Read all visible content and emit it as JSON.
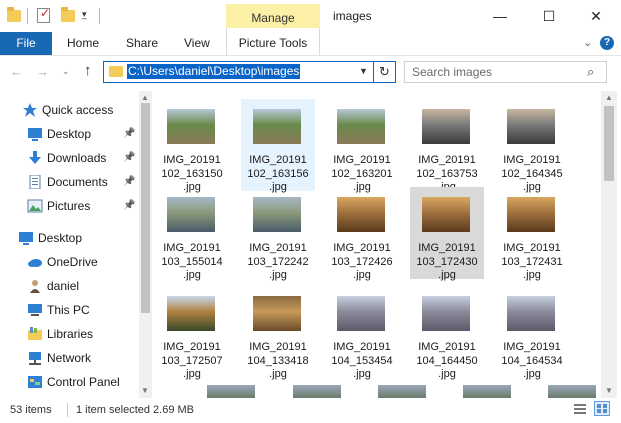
{
  "title_bar": {
    "contextual_tab": "Manage",
    "window_title": "images",
    "minimize_glyph": "—",
    "maximize_glyph": "☐",
    "close_glyph": "✕"
  },
  "ribbon": {
    "tabs": [
      "File",
      "Home",
      "Share",
      "View",
      "Picture Tools"
    ],
    "expand_glyph": "⌄",
    "help_glyph": "?"
  },
  "address_bar": {
    "path": "C:\\Users\\daniel\\Desktop\\images",
    "search_placeholder": "Search images",
    "back_glyph": "←",
    "forward_glyph": "→",
    "recent_glyph": "⌄",
    "up_glyph": "↑",
    "refresh_glyph": "↻",
    "search_glyph": "⌕"
  },
  "nav_pane": {
    "items": [
      {
        "label": "Quick access",
        "icon": "star-icon",
        "pinned": false
      },
      {
        "label": "Desktop",
        "icon": "desktop-icon",
        "pinned": true
      },
      {
        "label": "Downloads",
        "icon": "download-icon",
        "pinned": true
      },
      {
        "label": "Documents",
        "icon": "documents-icon",
        "pinned": true
      },
      {
        "label": "Pictures",
        "icon": "pictures-icon",
        "pinned": true
      },
      {
        "label": "Desktop",
        "icon": "desktop-icon",
        "pinned": false
      },
      {
        "label": "OneDrive",
        "icon": "cloud-icon",
        "pinned": false
      },
      {
        "label": "daniel",
        "icon": "user-icon",
        "pinned": false
      },
      {
        "label": "This PC",
        "icon": "computer-icon",
        "pinned": false
      },
      {
        "label": "Libraries",
        "icon": "libraries-icon",
        "pinned": false
      },
      {
        "label": "Network",
        "icon": "network-icon",
        "pinned": false
      },
      {
        "label": "Control Panel",
        "icon": "control-panel-icon",
        "pinned": false
      }
    ]
  },
  "files": [
    {
      "name": "IMG_20191\n102_163150\n.jpg",
      "state": "normal",
      "tone": "mountain"
    },
    {
      "name": "IMG_20191\n102_163156\n.jpg",
      "state": "hover",
      "tone": "mountain"
    },
    {
      "name": "IMG_20191\n102_163201\n.jpg",
      "state": "normal",
      "tone": "mountain"
    },
    {
      "name": "IMG_20191\n102_163753\n.jpg",
      "state": "normal",
      "tone": "bike"
    },
    {
      "name": "IMG_20191\n102_164345\n.jpg",
      "state": "normal",
      "tone": "bike"
    },
    {
      "name": "IMG_20191\n103_155014\n.jpg",
      "state": "normal",
      "tone": "valley"
    },
    {
      "name": "IMG_20191\n103_172242\n.jpg",
      "state": "normal",
      "tone": "valley"
    },
    {
      "name": "IMG_20191\n103_172426\n.jpg",
      "state": "normal",
      "tone": "sunset"
    },
    {
      "name": "IMG_20191\n103_172430\n.jpg",
      "state": "selected",
      "tone": "sunset"
    },
    {
      "name": "IMG_20191\n103_172431\n.jpg",
      "state": "normal",
      "tone": "sunset"
    },
    {
      "name": "IMG_20191\n103_172507\n.jpg",
      "state": "normal",
      "tone": "trees"
    },
    {
      "name": "IMG_20191\n104_133418\n.jpg",
      "state": "normal",
      "tone": "arch"
    },
    {
      "name": "IMG_20191\n104_153454\n.jpg",
      "state": "normal",
      "tone": "street"
    },
    {
      "name": "IMG_20191\n104_164450\n.jpg",
      "state": "normal",
      "tone": "street"
    },
    {
      "name": "IMG_20191\n104_164534\n.jpg",
      "state": "normal",
      "tone": "street"
    }
  ],
  "status": {
    "count": "53 items",
    "selection": "1 item selected  2.69 MB"
  },
  "colors": {
    "accent": "#1968b5",
    "manage_tab": "#fcf0a6",
    "hover_bg": "#e5f3ff",
    "selected_bg": "#d9d9d9"
  }
}
